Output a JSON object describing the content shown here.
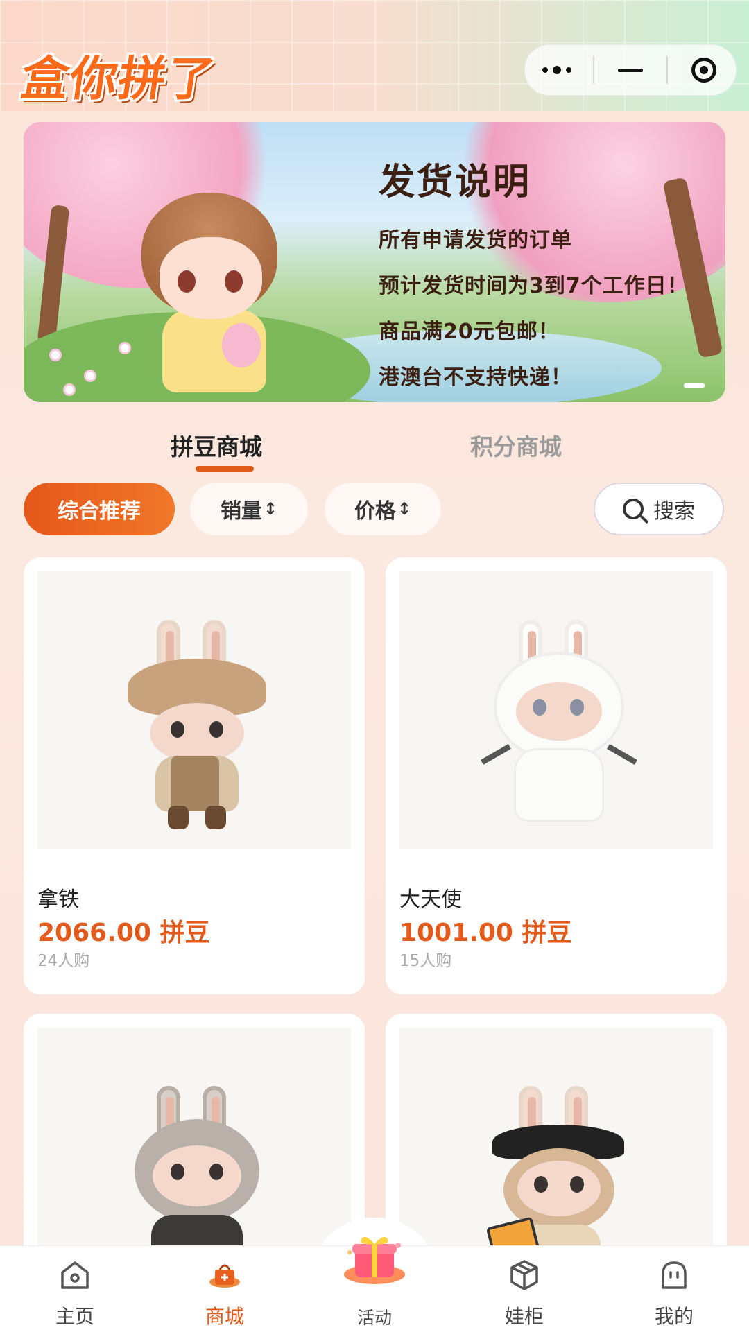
{
  "header": {
    "logo_text": "盒你拼了",
    "capsule": {
      "more_icon": "more-dots-icon",
      "minimize_icon": "minimize-icon",
      "close_icon": "target-close-icon"
    }
  },
  "banner": {
    "title": "发货说明",
    "lines": [
      "所有申请发货的订单",
      "预计发货时间为3到7个工作日！",
      "商品满20元包邮！",
      "港澳台不支持快递！"
    ]
  },
  "tabs": [
    {
      "label": "拼豆商城",
      "active": true
    },
    {
      "label": "积分商城",
      "active": false
    }
  ],
  "filters": {
    "recommend": "综合推荐",
    "sales": "销量",
    "price": "价格",
    "sort_icon": "↕",
    "search": "搜索"
  },
  "products": [
    {
      "name": "拿铁",
      "price": "2066.00 拼豆",
      "sold": "24人购"
    },
    {
      "name": "大天使",
      "price": "1001.00 拼豆",
      "sold": "15人购"
    },
    {
      "name": "",
      "price": "",
      "sold": ""
    },
    {
      "name": "",
      "price": "",
      "sold": ""
    }
  ],
  "nav": [
    {
      "label": "主页",
      "icon": "home-icon",
      "active": false
    },
    {
      "label": "商城",
      "icon": "shop-bag-icon",
      "active": true
    },
    {
      "label": "活动",
      "icon": "gift-box-icon",
      "active": false
    },
    {
      "label": "娃柜",
      "icon": "box-icon",
      "active": false
    },
    {
      "label": "我的",
      "icon": "profile-icon",
      "active": false
    }
  ],
  "colors": {
    "accent": "#e5581a",
    "price": "#e45a1b"
  }
}
